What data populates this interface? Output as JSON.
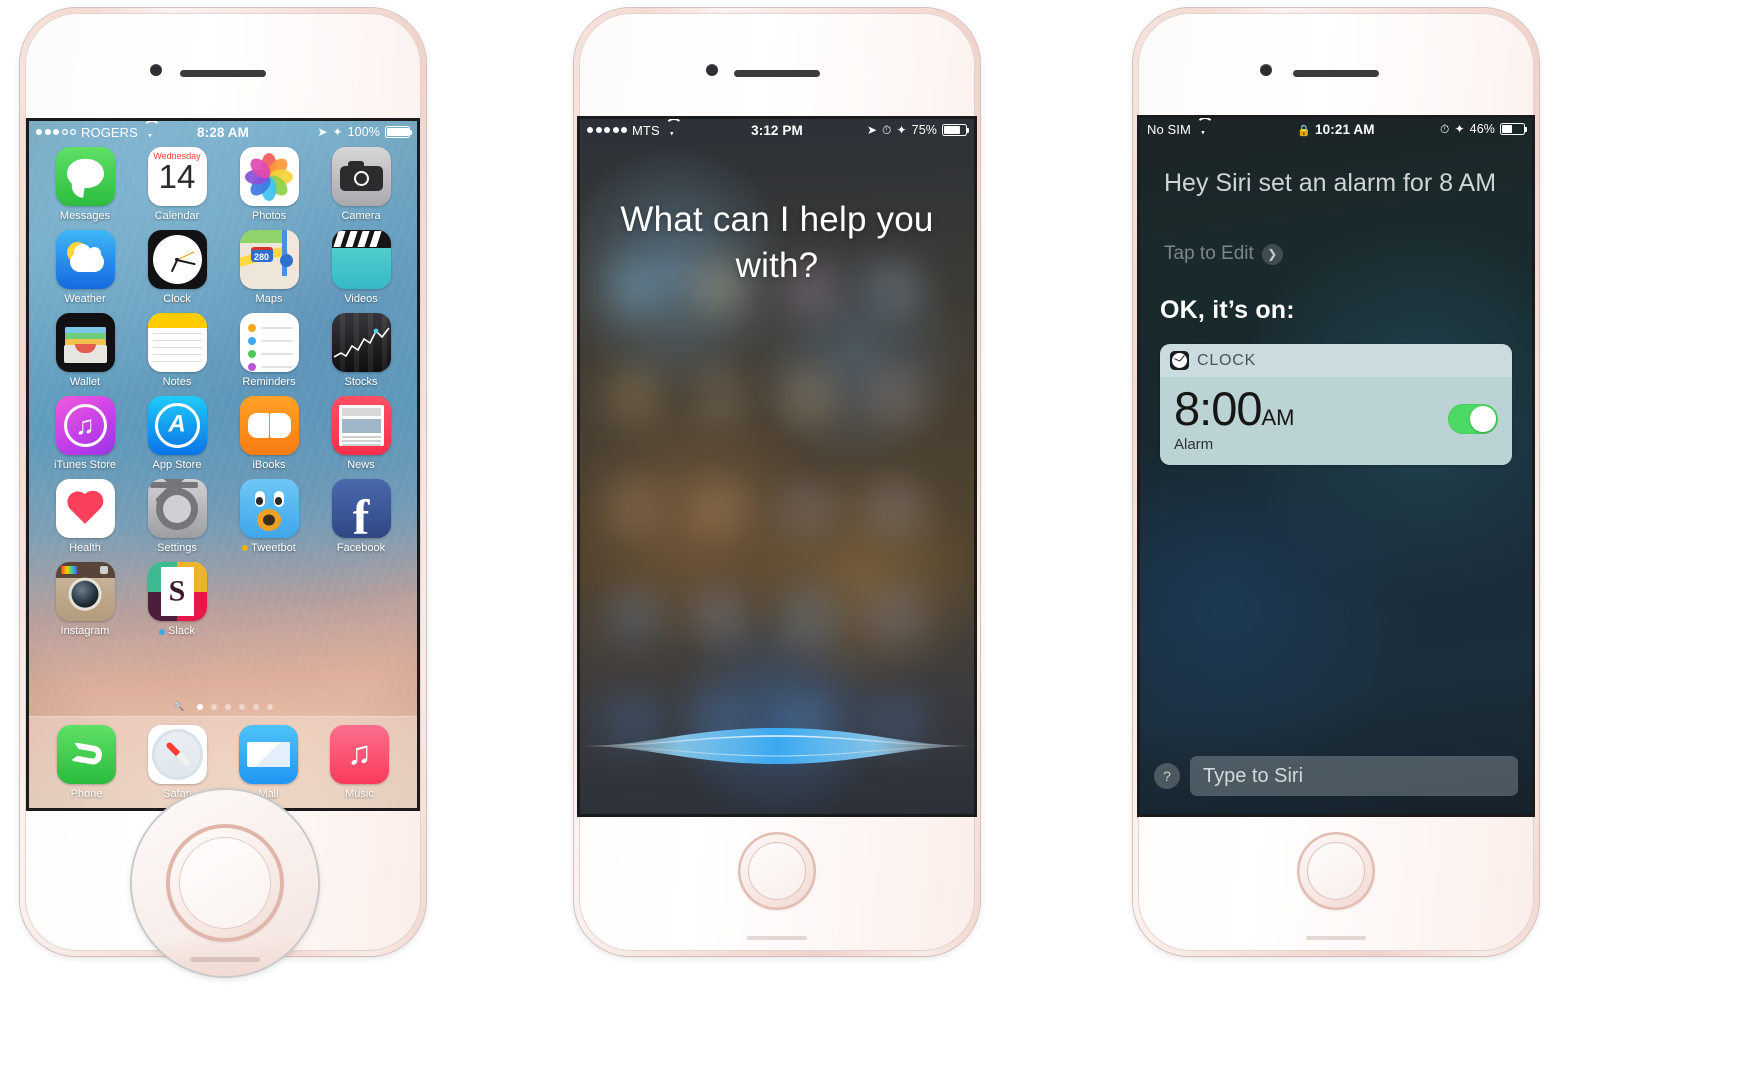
{
  "phones": {
    "home": {
      "status": {
        "carrier": "ROGERS",
        "signal_filled": 3,
        "signal_total": 5,
        "time": "8:28 AM",
        "battery_pct": "100%",
        "battery_level": 100,
        "icons": [
          "wifi-icon",
          "location-arrow-icon",
          "bluetooth-icon",
          "battery-icon"
        ]
      },
      "apps": [
        {
          "label": "Messages",
          "icon": "messages-icon"
        },
        {
          "label": "Calendar",
          "icon": "calendar-icon",
          "day": "Wednesday",
          "date": "14"
        },
        {
          "label": "Photos",
          "icon": "photos-icon"
        },
        {
          "label": "Camera",
          "icon": "camera-icon"
        },
        {
          "label": "Weather",
          "icon": "weather-icon"
        },
        {
          "label": "Clock",
          "icon": "clock-icon"
        },
        {
          "label": "Maps",
          "icon": "maps-icon",
          "shield": "280"
        },
        {
          "label": "Videos",
          "icon": "videos-icon"
        },
        {
          "label": "Wallet",
          "icon": "wallet-icon"
        },
        {
          "label": "Notes",
          "icon": "notes-icon"
        },
        {
          "label": "Reminders",
          "icon": "reminders-icon"
        },
        {
          "label": "Stocks",
          "icon": "stocks-icon"
        },
        {
          "label": "iTunes Store",
          "icon": "itunes-store-icon"
        },
        {
          "label": "App Store",
          "icon": "app-store-icon"
        },
        {
          "label": "iBooks",
          "icon": "ibooks-icon"
        },
        {
          "label": "News",
          "icon": "news-icon"
        },
        {
          "label": "Health",
          "icon": "health-icon"
        },
        {
          "label": "Settings",
          "icon": "settings-icon"
        },
        {
          "label": "Tweetbot",
          "icon": "tweetbot-icon",
          "dot": "#f0b400"
        },
        {
          "label": "Facebook",
          "icon": "facebook-icon"
        },
        {
          "label": "Instagram",
          "icon": "instagram-icon"
        },
        {
          "label": "Slack",
          "icon": "slack-icon",
          "dot": "#3ea7ea"
        }
      ],
      "page_dots": {
        "count": 6,
        "active": 1,
        "search_icon": "search-icon"
      },
      "dock": [
        {
          "label": "Phone",
          "icon": "phone-icon"
        },
        {
          "label": "Safari",
          "icon": "safari-icon"
        },
        {
          "label": "Mail",
          "icon": "mail-icon"
        },
        {
          "label": "Music",
          "icon": "music-icon"
        }
      ]
    },
    "siri_listening": {
      "status": {
        "carrier": "MTS",
        "signal_filled": 5,
        "signal_total": 5,
        "time": "3:12 PM",
        "battery_pct": "75%",
        "battery_level": 75,
        "icons": [
          "wifi-icon",
          "location-arrow-icon",
          "alarm-clock-icon",
          "bluetooth-icon",
          "battery-icon"
        ]
      },
      "prompt": "What can I help you with?"
    },
    "siri_result": {
      "status": {
        "carrier": "No SIM",
        "time": "10:21 AM",
        "battery_pct": "46%",
        "battery_level": 46,
        "icons": [
          "wifi-icon",
          "lock-icon",
          "alarm-clock-icon",
          "bluetooth-icon",
          "battery-icon"
        ]
      },
      "query": "Hey Siri set an alarm for 8 AM",
      "edit_label": "Tap to Edit",
      "chevron_icon": "chevron-right-icon",
      "confirmation": "OK, it’s on:",
      "alarm_card": {
        "app_name": "CLOCK",
        "app_icon": "clock-icon",
        "time": "8:00",
        "ampm": "AM",
        "sub_label": "Alarm",
        "toggle_on": true,
        "toggle_color": "#4cd964"
      },
      "help_icon": "question-mark-icon",
      "type_placeholder": "Type to Siri"
    }
  }
}
